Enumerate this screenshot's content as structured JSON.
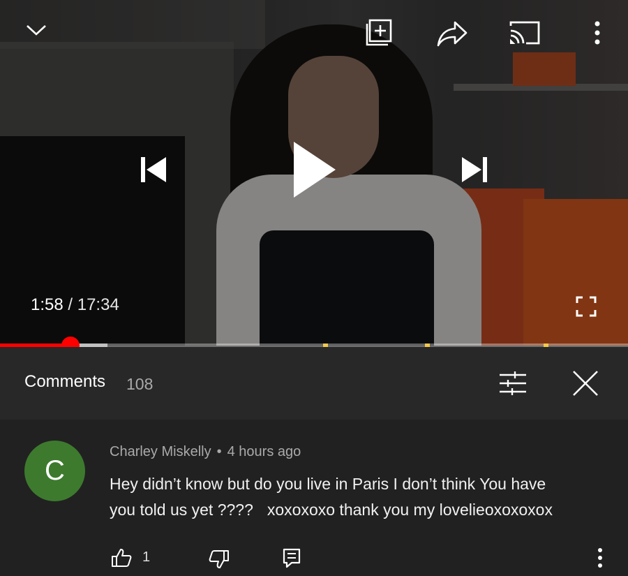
{
  "player": {
    "current_time": "1:58",
    "separator": "/",
    "duration": "17:34",
    "progress_fraction": 0.112,
    "buffered_fraction": 0.171,
    "chapter_marker_fractions": [
      0.514,
      0.677,
      0.866
    ],
    "icons": {
      "collapse": "chevron-down-icon",
      "add_to_playlist": "add-to-playlist-icon",
      "share": "share-icon",
      "cast": "cast-icon",
      "more": "more-vertical-icon",
      "previous": "skip-previous-icon",
      "play": "play-icon",
      "next": "skip-next-icon",
      "fullscreen": "fullscreen-icon"
    },
    "colors": {
      "progress": "#ff0000",
      "chapter_marker": "#f2c94c"
    }
  },
  "comments_panel": {
    "title": "Comments",
    "count": "108",
    "icons": {
      "sort": "sort-filter-icon",
      "close": "close-icon"
    }
  },
  "comment": {
    "avatar_letter": "C",
    "avatar_color": "#3d7a2e",
    "author": "Charley Miskelly",
    "separator": "•",
    "time": "4 hours ago",
    "text_line1": "Hey didn’t know but do you live in Paris I don’t think You have",
    "text_line2a": "you told us yet ????",
    "text_line2b": "xoxoxoxo thank you my lovelieoxoxoxox",
    "like_count": "1",
    "icons": {
      "like": "thumbs-up-icon",
      "dislike": "thumbs-down-icon",
      "reply": "reply-icon",
      "more": "more-vertical-icon"
    }
  }
}
